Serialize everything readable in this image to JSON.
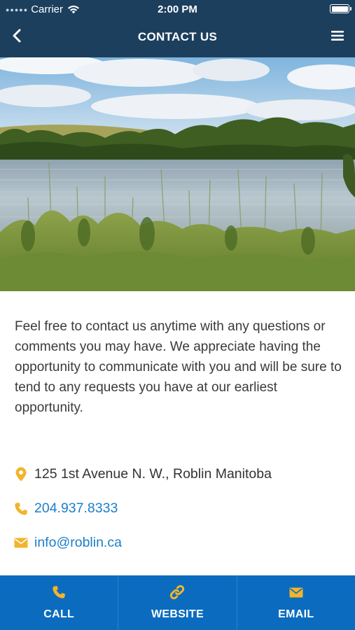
{
  "status_bar": {
    "carrier": "Carrier",
    "time": "2:00 PM"
  },
  "nav": {
    "title": "CONTACT US"
  },
  "intro_text": "Feel free to contact us anytime with any questions or comments you may have. We appreciate having the opportunity to communicate with you and will be sure to tend to any requests you have at our earliest opportunity.",
  "contact": {
    "address": "125 1st Avenue N. W., Roblin Manitoba",
    "phone": "204.937.8333",
    "email": "info@roblin.ca"
  },
  "tabs": [
    {
      "label": "CALL",
      "icon": "phone-icon"
    },
    {
      "label": "WEBSITE",
      "icon": "link-icon"
    },
    {
      "label": "EMAIL",
      "icon": "envelope-icon"
    }
  ],
  "colors": {
    "nav_background": "#1d3f5e",
    "tabbar_background": "#0b6cbf",
    "icon_accent": "#f2b42a",
    "link": "#1c7ec9"
  }
}
